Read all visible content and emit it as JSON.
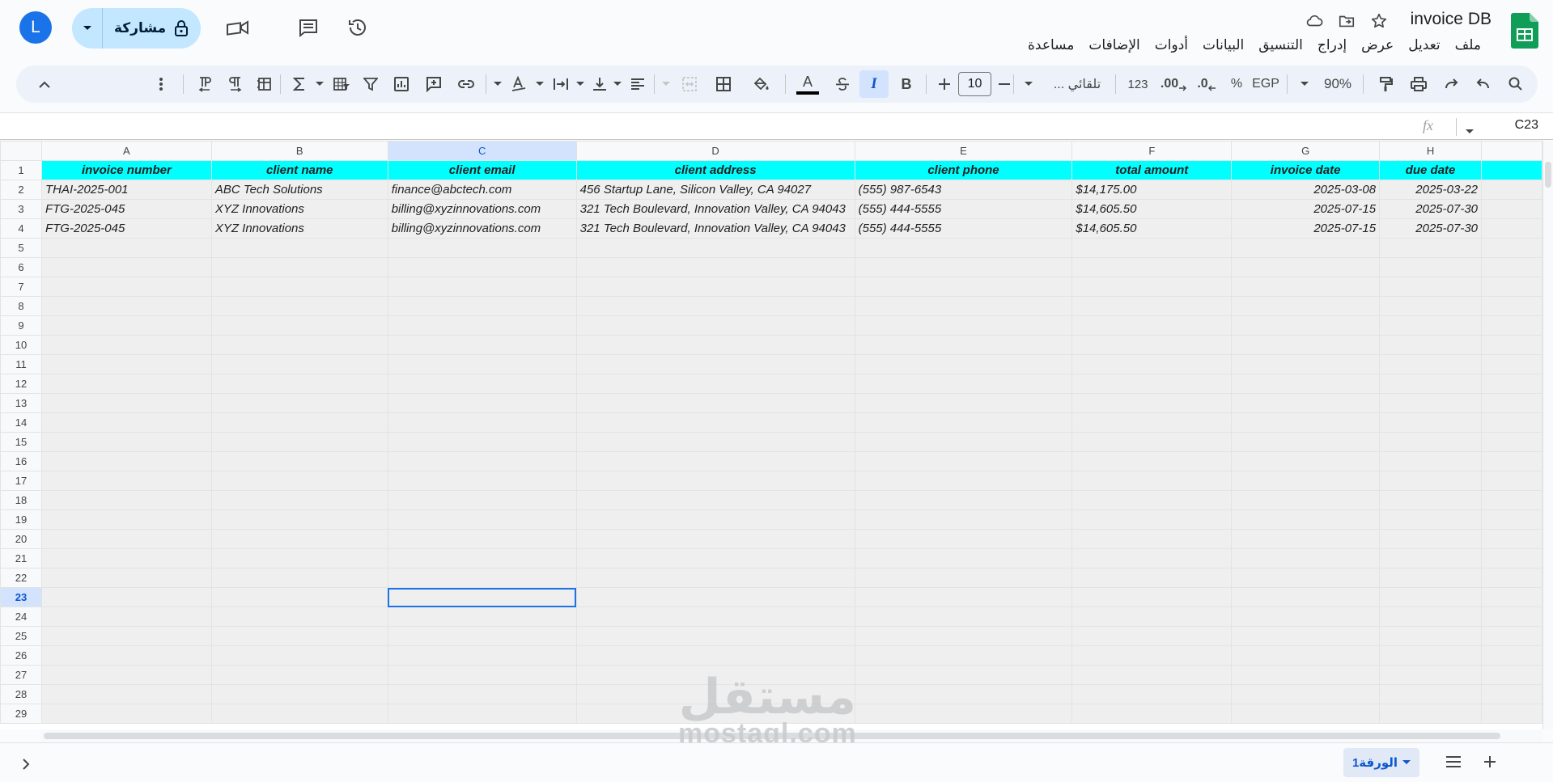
{
  "app": {
    "doc_title": "invoice DB",
    "menu": [
      "ملف",
      "تعديل",
      "عرض",
      "إدراج",
      "التنسيق",
      "البيانات",
      "أدوات",
      "الإضافات",
      "مساعدة"
    ],
    "share_label": "مشاركة",
    "avatar_letter": "L",
    "brand_color": "#0f9d58"
  },
  "toolbar": {
    "zoom": "90%",
    "currency": "EGP",
    "percent": "%",
    "decrease_decimal": ".0",
    "increase_decimal": ".00",
    "number_format": "123",
    "font": "تلقائي ...",
    "font_size": "10",
    "bold": "B",
    "italic": "I",
    "text_color_label": "A"
  },
  "formula_bar": {
    "name_box": "C23",
    "fx": "fx",
    "content": ""
  },
  "sheet": {
    "columns": [
      "A",
      "B",
      "C",
      "D",
      "E",
      "F",
      "G",
      "H"
    ],
    "selected_column": "C",
    "selected_row": 23,
    "row_numbers": [
      1,
      2,
      3,
      4,
      5,
      6,
      7,
      8,
      9,
      10,
      11,
      12,
      13,
      14,
      15,
      16,
      17,
      18,
      19,
      20,
      21,
      22,
      23,
      24,
      25,
      26,
      27,
      28,
      29
    ],
    "headers": [
      "invoice number",
      "client name",
      "client email",
      "client address",
      "client phone",
      "total amount",
      "invoice date",
      "due date"
    ],
    "rows": [
      [
        "THAI-2025-001",
        "ABC Tech Solutions",
        "finance@abctech.com",
        "456 Startup Lane, Silicon Valley, CA 94027",
        "(555) 987-6543",
        "$14,175.00",
        "2025-03-08",
        "2025-03-22"
      ],
      [
        "FTG-2025-045",
        "XYZ Innovations",
        "billing@xyzinnovations.com",
        "321 Tech Boulevard, Innovation Valley, CA 94043",
        "(555) 444-5555",
        "$14,605.50",
        "2025-07-15",
        "2025-07-30"
      ],
      [
        "FTG-2025-045",
        "XYZ Innovations",
        "billing@xyzinnovations.com",
        "321 Tech Boulevard, Innovation Valley, CA 94043",
        "(555) 444-5555",
        "$14,605.50",
        "2025-07-15",
        "2025-07-30"
      ]
    ],
    "header_fill": "#00ffff",
    "data_fill": "#efefef"
  },
  "bottom": {
    "sheet_tab": "الورقة1"
  },
  "watermark": {
    "arabic": "مستقل",
    "latin": "mostaql.com"
  }
}
